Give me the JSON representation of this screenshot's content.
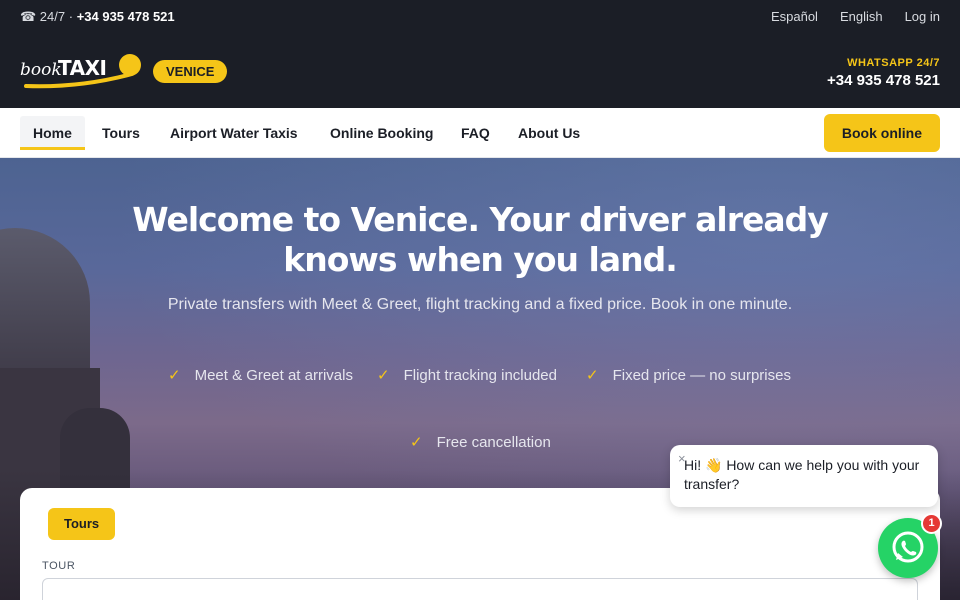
{
  "topbar": {
    "phone_prefix": "☎ 24/7 ·",
    "phone_number": "+34 935 478 521",
    "languages": [
      "Español",
      "English",
      "Log in"
    ]
  },
  "brand": {
    "logo_book": "book",
    "logo_taxi": "TAXI",
    "city_badge": "VENICE",
    "whatsapp_label": "WHATSAPP 24/7",
    "whatsapp_number": "+34 935 478 521"
  },
  "nav": {
    "items": [
      "Home",
      "Tours",
      "Airport Water Taxis",
      "Online Booking",
      "FAQ",
      "About Us"
    ],
    "active": "Home",
    "cta": "Book online"
  },
  "hero": {
    "title": "Welcome to Venice. Your driver already knows when you land.",
    "subtitle": "Private transfers with Meet & Greet, flight tracking and a fixed price. Book in one minute.",
    "features": [
      "Meet & Greet at arrivals",
      "Flight tracking included",
      "Fixed price — no surprises",
      "Free cancellation"
    ],
    "check_glyph": "✓"
  },
  "booking": {
    "tab": "Tours",
    "field_label": "TOUR"
  },
  "chat": {
    "close_glyph": "×",
    "message": "Hi! 👋 How can we help you with your transfer?",
    "badge": "1"
  },
  "colors": {
    "accent": "#f5c518",
    "dark": "#1b1e26",
    "whatsapp": "#25d366",
    "badge": "#e53935"
  },
  "icons": [
    "phone-icon",
    "check-icon",
    "close-icon",
    "whatsapp-icon"
  ]
}
